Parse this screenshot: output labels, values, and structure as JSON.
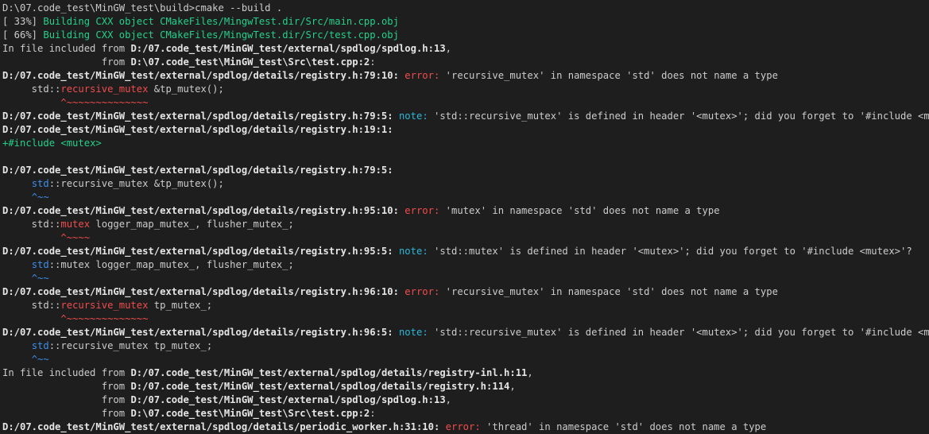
{
  "theme": {
    "background": "#1e1e1e",
    "default": "#cccccc",
    "bold": "#e5e5e5",
    "green": "#23d18b",
    "red": "#f14c4c",
    "cyan": "#29b8db",
    "blue": "#3b8eea"
  },
  "lines": [
    [
      {
        "t": "D:\\07.code_test\\MinGW_test\\build>cmake --build ."
      }
    ],
    [
      {
        "t": "[ 33%] "
      },
      {
        "t": "Building CXX object CMakeFiles/MingwTest.dir/Src/main.cpp.obj",
        "c": "green"
      }
    ],
    [
      {
        "t": "[ 66%] "
      },
      {
        "t": "Building CXX object CMakeFiles/MingwTest.dir/Src/test.cpp.obj",
        "c": "green"
      }
    ],
    [
      {
        "t": "In file included from "
      },
      {
        "t": "D:/07.code_test/MinGW_test/external/spdlog/spdlog.h:13",
        "c": "bold"
      },
      {
        "t": ","
      }
    ],
    [
      {
        "t": "                 from "
      },
      {
        "t": "D:\\07.code_test\\MinGW_test\\Src\\test.cpp:2",
        "c": "bold"
      },
      {
        "t": ":"
      }
    ],
    [
      {
        "t": "D:/07.code_test/MinGW_test/external/spdlog/details/registry.h:79:10:",
        "c": "bold"
      },
      {
        "t": " "
      },
      {
        "t": "error:",
        "c": "red"
      },
      {
        "t": " 'recursive_mutex' in namespace 'std' does not name a type"
      }
    ],
    [
      {
        "t": "     std::"
      },
      {
        "t": "recursive_mutex",
        "c": "red"
      },
      {
        "t": " &tp_mutex();"
      }
    ],
    [
      {
        "t": "          "
      },
      {
        "t": "^~~~~~~~~~~~~~~",
        "c": "red"
      }
    ],
    [
      {
        "t": "D:/07.code_test/MinGW_test/external/spdlog/details/registry.h:79:5:",
        "c": "bold"
      },
      {
        "t": " "
      },
      {
        "t": "note:",
        "c": "cyan"
      },
      {
        "t": " 'std::recursive_mutex' is defined in header '<mutex>'; did you forget to '#include <mutex>'?"
      }
    ],
    [
      {
        "t": "D:/07.code_test/MinGW_test/external/spdlog/details/registry.h:19:1:",
        "c": "bold"
      }
    ],
    [
      {
        "t": "+",
        "c": "green"
      },
      {
        "t": "#include <mutex>",
        "c": "green"
      }
    ],
    [
      {
        "t": " "
      }
    ],
    [
      {
        "t": "D:/07.code_test/MinGW_test/external/spdlog/details/registry.h:79:5:",
        "c": "bold"
      }
    ],
    [
      {
        "t": "     "
      },
      {
        "t": "std",
        "c": "blue"
      },
      {
        "t": "::recursive_mutex &tp_mutex();"
      }
    ],
    [
      {
        "t": "     "
      },
      {
        "t": "^~~",
        "c": "blue"
      }
    ],
    [
      {
        "t": "D:/07.code_test/MinGW_test/external/spdlog/details/registry.h:95:10:",
        "c": "bold"
      },
      {
        "t": " "
      },
      {
        "t": "error:",
        "c": "red"
      },
      {
        "t": " 'mutex' in namespace 'std' does not name a type"
      }
    ],
    [
      {
        "t": "     std::"
      },
      {
        "t": "mutex",
        "c": "red"
      },
      {
        "t": " logger_map_mutex_, flusher_mutex_;"
      }
    ],
    [
      {
        "t": "          "
      },
      {
        "t": "^~~~~",
        "c": "red"
      }
    ],
    [
      {
        "t": "D:/07.code_test/MinGW_test/external/spdlog/details/registry.h:95:5:",
        "c": "bold"
      },
      {
        "t": " "
      },
      {
        "t": "note:",
        "c": "cyan"
      },
      {
        "t": " 'std::mutex' is defined in header '<mutex>'; did you forget to '#include <mutex>'?"
      }
    ],
    [
      {
        "t": "     "
      },
      {
        "t": "std",
        "c": "blue"
      },
      {
        "t": "::mutex logger_map_mutex_, flusher_mutex_;"
      }
    ],
    [
      {
        "t": "     "
      },
      {
        "t": "^~~",
        "c": "blue"
      }
    ],
    [
      {
        "t": "D:/07.code_test/MinGW_test/external/spdlog/details/registry.h:96:10:",
        "c": "bold"
      },
      {
        "t": " "
      },
      {
        "t": "error:",
        "c": "red"
      },
      {
        "t": " 'recursive_mutex' in namespace 'std' does not name a type"
      }
    ],
    [
      {
        "t": "     std::"
      },
      {
        "t": "recursive_mutex",
        "c": "red"
      },
      {
        "t": " tp_mutex_;"
      }
    ],
    [
      {
        "t": "          "
      },
      {
        "t": "^~~~~~~~~~~~~~~",
        "c": "red"
      }
    ],
    [
      {
        "t": "D:/07.code_test/MinGW_test/external/spdlog/details/registry.h:96:5:",
        "c": "bold"
      },
      {
        "t": " "
      },
      {
        "t": "note:",
        "c": "cyan"
      },
      {
        "t": " 'std::recursive_mutex' is defined in header '<mutex>'; did you forget to '#include <mutex>'?"
      }
    ],
    [
      {
        "t": "     "
      },
      {
        "t": "std",
        "c": "blue"
      },
      {
        "t": "::recursive_mutex tp_mutex_;"
      }
    ],
    [
      {
        "t": "     "
      },
      {
        "t": "^~~",
        "c": "blue"
      }
    ],
    [
      {
        "t": "In file included from "
      },
      {
        "t": "D:/07.code_test/MinGW_test/external/spdlog/details/registry-inl.h:11",
        "c": "bold"
      },
      {
        "t": ","
      }
    ],
    [
      {
        "t": "                 from "
      },
      {
        "t": "D:/07.code_test/MinGW_test/external/spdlog/details/registry.h:114",
        "c": "bold"
      },
      {
        "t": ","
      }
    ],
    [
      {
        "t": "                 from "
      },
      {
        "t": "D:/07.code_test/MinGW_test/external/spdlog/spdlog.h:13",
        "c": "bold"
      },
      {
        "t": ","
      }
    ],
    [
      {
        "t": "                 from "
      },
      {
        "t": "D:\\07.code_test\\MinGW_test\\Src\\test.cpp:2",
        "c": "bold"
      },
      {
        "t": ":"
      }
    ],
    [
      {
        "t": "D:/07.code_test/MinGW_test/external/spdlog/details/periodic_worker.h:31:10:",
        "c": "bold"
      },
      {
        "t": " "
      },
      {
        "t": "error:",
        "c": "red"
      },
      {
        "t": " 'thread' in namespace 'std' does not name a type"
      }
    ]
  ]
}
